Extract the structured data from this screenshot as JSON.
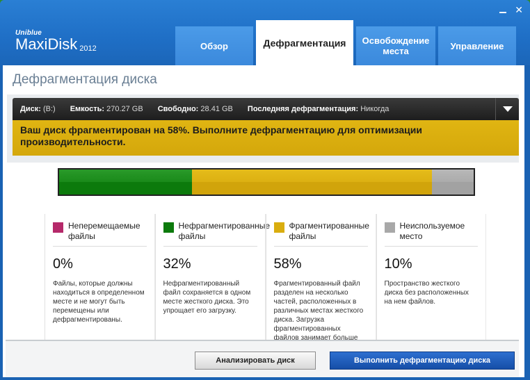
{
  "app": {
    "brand": "Uniblue",
    "product": "MaxiDisk",
    "year": "2012"
  },
  "titlebar": {
    "minimize": "_",
    "close": "✕"
  },
  "tabs": [
    {
      "label": "Обзор",
      "active": false
    },
    {
      "label": "Дефрагментация",
      "active": true
    },
    {
      "label": "Освобождение места",
      "active": false
    },
    {
      "label": "Управление",
      "active": false
    }
  ],
  "page": {
    "title": "Дефрагментация диска"
  },
  "disk": {
    "disk_label": "Диск:",
    "disk_value": "(B:)",
    "capacity_label": "Емкость:",
    "capacity_value": "270.27 GB",
    "free_label": "Свободно:",
    "free_value": "28.41 GB",
    "last_label": "Последняя дефрагментация:",
    "last_value": "Никогда"
  },
  "warning": "Ваш диск фрагментирован на 58%. Выполните дефрагментацию для оптимизации производительности.",
  "fragmentation_bar": {
    "unmovable": 0,
    "unfragmented": 32,
    "fragmented": 58,
    "unused": 10
  },
  "legend": [
    {
      "label": "Неперемещаемые файлы",
      "color": "#b5296a",
      "pct": "0%",
      "desc": "Файлы, которые должны находиться в определенном месте и не могут быть перемещены или дефрагментированы."
    },
    {
      "label": "Нефрагментированные файлы",
      "color": "#0c7a0c",
      "pct": "32%",
      "desc": "Нефрагментированный файл сохраняется в одном месте жесткого диска. Это упрощает его загрузку."
    },
    {
      "label": "Фрагментированные файлы",
      "color": "#d9ad0f",
      "pct": "58%",
      "desc": "Фрагментированный файл разделен на несколько частей, расположенных в различных местах жесткого диска. Загрузка фрагментированных файлов занимает больше времени."
    },
    {
      "label": "Неиспользуемое место",
      "color": "#a8a8a8",
      "pct": "10%",
      "desc": "Пространство жесткого диска без расположенных на нем файлов."
    }
  ],
  "buttons": {
    "analyze": "Анализировать диск",
    "defrag": "Выполнить дефрагментацию диска"
  }
}
